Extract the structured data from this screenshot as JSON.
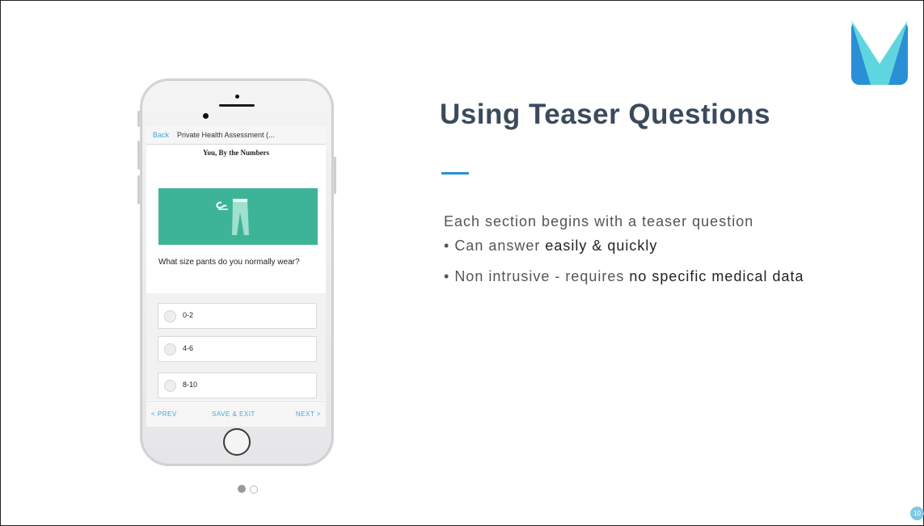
{
  "slide": {
    "title": "Using Teaser Questions",
    "intro": "Each section begins with a teaser question",
    "bullets": [
      {
        "prefix": "Can answer ",
        "emphasis": "easily & quickly",
        "suffix": ""
      },
      {
        "prefix": "Non intrusive - requires ",
        "emphasis": "no specific medical data",
        "suffix": ""
      }
    ],
    "page_number": "10",
    "accent_color": "#2e8fd1"
  },
  "logo": {
    "icon": "v-logo-icon"
  },
  "phone": {
    "navbar": {
      "back": "Back",
      "title": "Private Health Assessment (..."
    },
    "section_title": "You, By the Numbers",
    "banner_icon": "pants-icon",
    "question": "What size pants do you normally wear?",
    "options": [
      "0-2",
      "4-6",
      "8-10"
    ],
    "footer": {
      "prev": "< PREV",
      "save": "SAVE & EXIT",
      "next": "NEXT >"
    }
  },
  "carousel": {
    "active_index": 0,
    "count": 2
  }
}
